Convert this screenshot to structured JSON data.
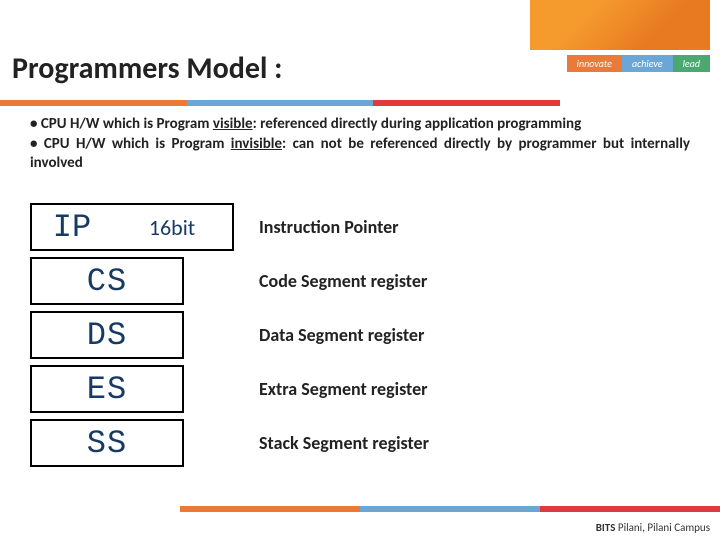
{
  "header": {
    "title": "Programmers Model :",
    "tags": [
      "innovate",
      "achieve",
      "lead"
    ]
  },
  "body": {
    "bullet1_a": "• CPU H/W which is Program ",
    "bullet1_u": "visible",
    "bullet1_b": ": referenced directly during application programming",
    "bullet2_a": "• CPU H/W which is Program ",
    "bullet2_u": "invisible",
    "bullet2_b": ": can not be referenced directly by programmer but internally involved"
  },
  "registers": {
    "ip": {
      "name": "IP",
      "bits": "16bit",
      "desc": "Instruction Pointer"
    },
    "cs": {
      "name": "CS",
      "desc": "Code Segment register"
    },
    "ds": {
      "name": "DS",
      "desc": "Data Segment register"
    },
    "es": {
      "name": "ES",
      "desc": "Extra Segment register"
    },
    "ss": {
      "name": "SS",
      "desc": "Stack Segment register"
    }
  },
  "footer": {
    "bold": "BITS ",
    "rest": "Pilani, Pilani Campus"
  }
}
